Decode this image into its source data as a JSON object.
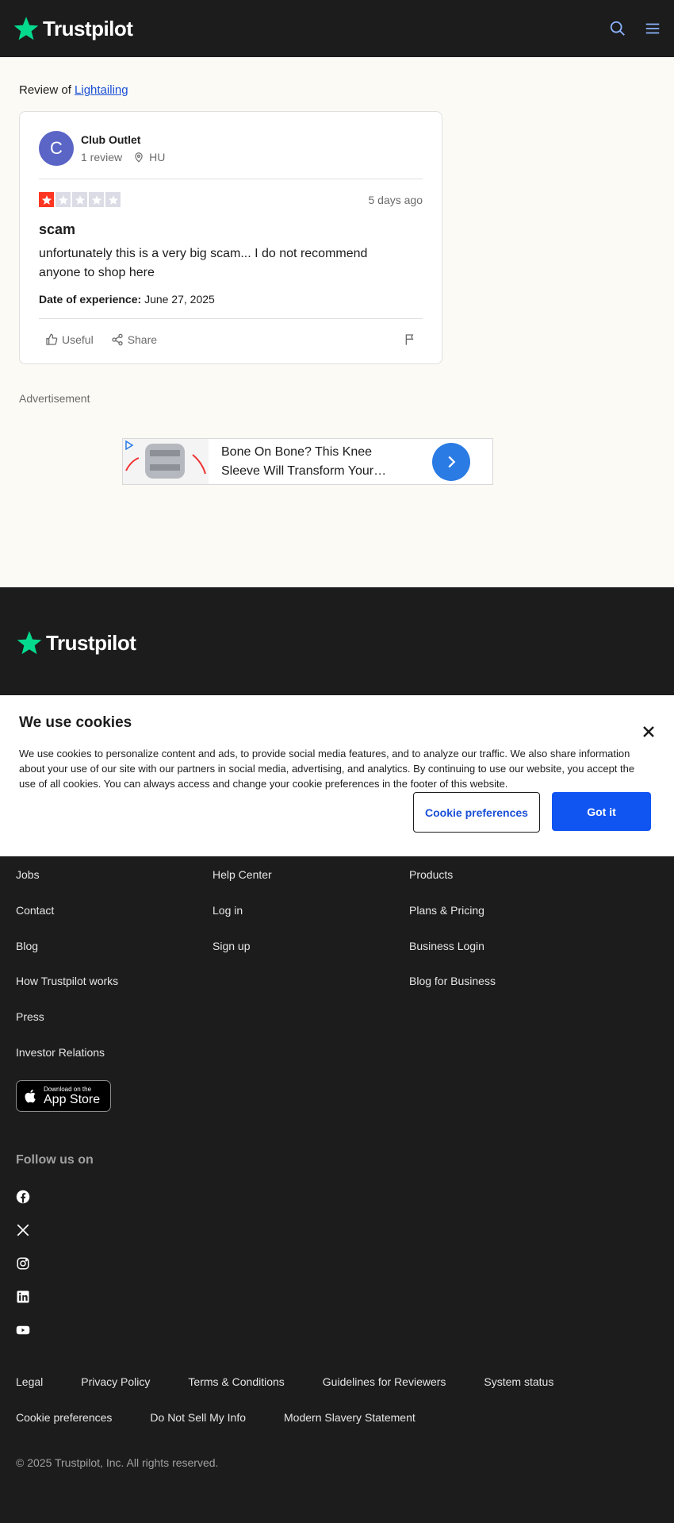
{
  "colors": {
    "brand_green": "#04da8d",
    "star_red": "#ff3722",
    "link_blue": "#1a4fd6",
    "button_blue": "#1055f2",
    "avatar": "#5a65c6"
  },
  "header": {
    "brand": "Trustpilot",
    "icons": [
      "search-icon",
      "menu-icon"
    ]
  },
  "review": {
    "prefix": "Review of",
    "company": "Lightailing",
    "user": {
      "initial": "C",
      "name": "Club Outlet",
      "reviews": "1 review",
      "country": "HU"
    },
    "rating": 1,
    "rating_max": 5,
    "date_ago": "5 days ago",
    "title": "scam",
    "text": "unfortunately this is a very big scam... I do not recommend anyone to shop here",
    "experience_label": "Date of experience:",
    "experience_date": "June 27, 2025",
    "useful_label": "Useful",
    "share_label": "Share"
  },
  "ad": {
    "label": "Advertisement",
    "text": "Bone On Bone? This Knee Sleeve Will Transform Your…"
  },
  "footer": {
    "brand": "Trustpilot"
  },
  "cookie": {
    "title": "We use cookies",
    "text": "We use cookies to personalize content and ads, to provide social media features, and to analyze our traffic. We also share information about your use of our site with our partners in social media, advertising, and analytics. By continuing to use our website, you accept the use of all cookies. You can always access and change your cookie preferences in the footer of this website.",
    "preferences_label": "Cookie preferences",
    "accept_label": "Got it"
  },
  "footer_links": {
    "col1": [
      "Jobs",
      "Contact",
      "Blog",
      "How Trustpilot works",
      "Press",
      "Investor Relations"
    ],
    "col2": [
      "Help Center",
      "Log in",
      "Sign up"
    ],
    "col3": [
      "Products",
      "Plans & Pricing",
      "Business Login",
      "Blog for Business"
    ]
  },
  "appstore": {
    "small": "Download on the",
    "big": "App Store"
  },
  "follow": {
    "title": "Follow us on",
    "icons": [
      "facebook-icon",
      "x-icon",
      "instagram-icon",
      "linkedin-icon",
      "youtube-icon"
    ]
  },
  "legal": {
    "row1": [
      "Legal",
      "Privacy Policy",
      "Terms & Conditions",
      "Guidelines for Reviewers",
      "System status"
    ],
    "row2": [
      "Cookie preferences",
      "Do Not Sell My Info",
      "Modern Slavery Statement"
    ]
  },
  "copyright": "© 2025 Trustpilot, Inc. All rights reserved."
}
